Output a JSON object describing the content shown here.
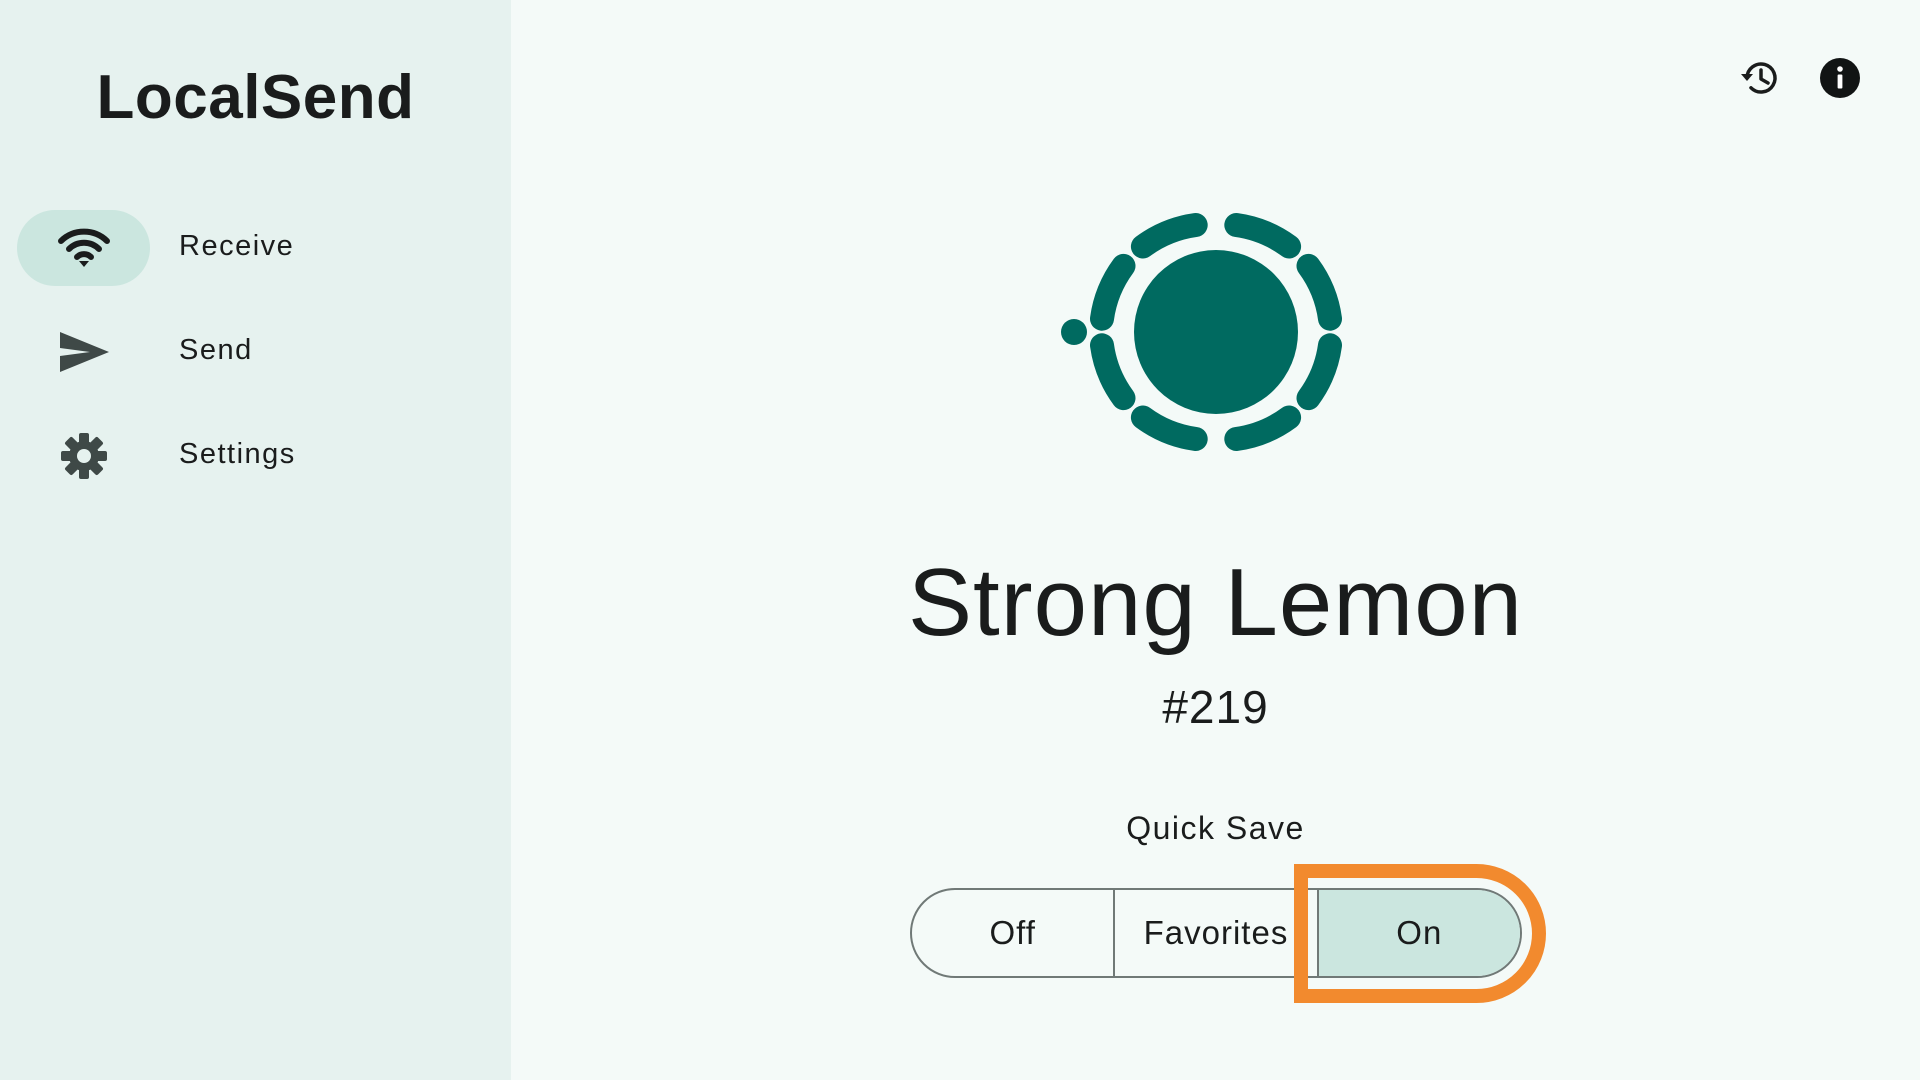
{
  "app": {
    "title": "LocalSend"
  },
  "sidebar": {
    "items": [
      {
        "label": "Receive",
        "icon": "wifi-icon",
        "active": true
      },
      {
        "label": "Send",
        "icon": "send-icon",
        "active": false
      },
      {
        "label": "Settings",
        "icon": "gear-icon",
        "active": false
      }
    ]
  },
  "header": {
    "actions": [
      {
        "icon": "history-icon"
      },
      {
        "icon": "info-icon"
      }
    ]
  },
  "main": {
    "device_name": "Strong Lemon",
    "device_id": "#219",
    "quick_save": {
      "label": "Quick Save",
      "options": [
        "Off",
        "Favorites",
        "On"
      ],
      "selected": "On"
    }
  },
  "colors": {
    "accent": "#006a60",
    "sidebar_bg": "#e6f2ef",
    "selected_bg": "#cbe6df",
    "highlight": "#f28a2e",
    "background": "#f4faf8"
  }
}
